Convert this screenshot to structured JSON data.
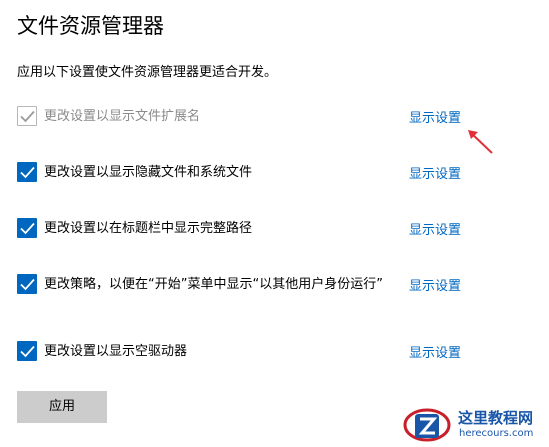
{
  "header": {
    "title": "文件资源管理器",
    "description": "应用以下设置使文件资源管理器更适合开发。"
  },
  "settings": [
    {
      "label": "更改设置以显示文件扩展名",
      "checked": true,
      "enabled": false,
      "link": "显示设置"
    },
    {
      "label": "更改设置以显示隐藏文件和系统文件",
      "checked": true,
      "enabled": true,
      "link": "显示设置"
    },
    {
      "label": "更改设置以在标题栏中显示完整路径",
      "checked": true,
      "enabled": true,
      "link": "显示设置"
    },
    {
      "label": "更改策略，以便在“开始”菜单中显示“以其他用户身份运行”",
      "checked": true,
      "enabled": true,
      "link": "显示设置"
    },
    {
      "label": "更改设置以显示空驱动器",
      "checked": true,
      "enabled": true,
      "link": "显示设置"
    }
  ],
  "apply_button": "应用",
  "watermark": {
    "name": "这里教程网",
    "url": "herecours.com"
  },
  "colors": {
    "accent": "#0067c0",
    "disabled_text": "#8a8a8a",
    "annotation_arrow": "#e0303a",
    "button_bg": "#cccccc"
  }
}
